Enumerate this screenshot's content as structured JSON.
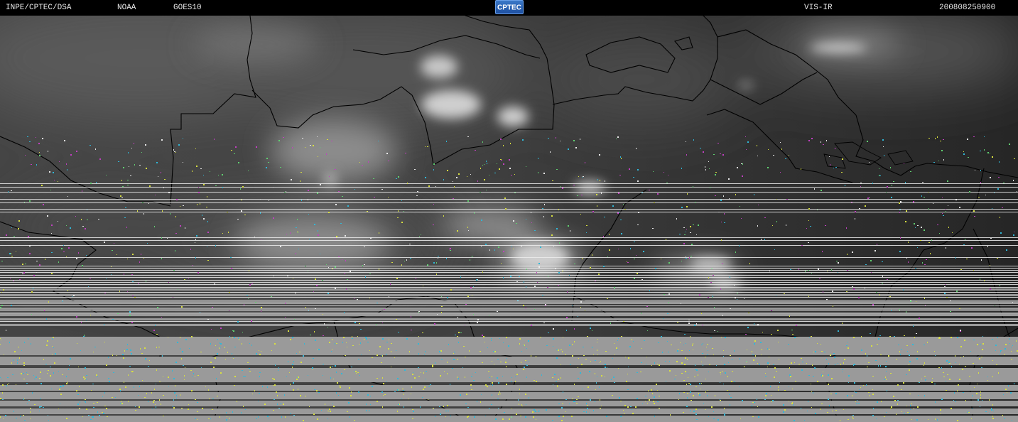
{
  "header": {
    "institution": "INPE/CPTEC/DSA",
    "agency": "NOAA",
    "satellite": "GOES10",
    "channel": "VIS-IR",
    "timestamp": "200808250900"
  },
  "logo": {
    "text": "CPTEC",
    "icon": "cptec-logo-icon",
    "color": "#2a62b8"
  },
  "imagery": {
    "type": "satellite-composite",
    "colors": {
      "land_base": "#3c3c3c",
      "ocean_dark": "#262626",
      "cloud_bright": "#d4d4d4",
      "border_lines": "#000000",
      "scanline_white": "#ececec",
      "missing_data_gray": "#9a9a9a",
      "noise_cyan": "#30b8d8",
      "noise_yellow": "#d8e040",
      "noise_magenta": "#c040c0"
    }
  }
}
